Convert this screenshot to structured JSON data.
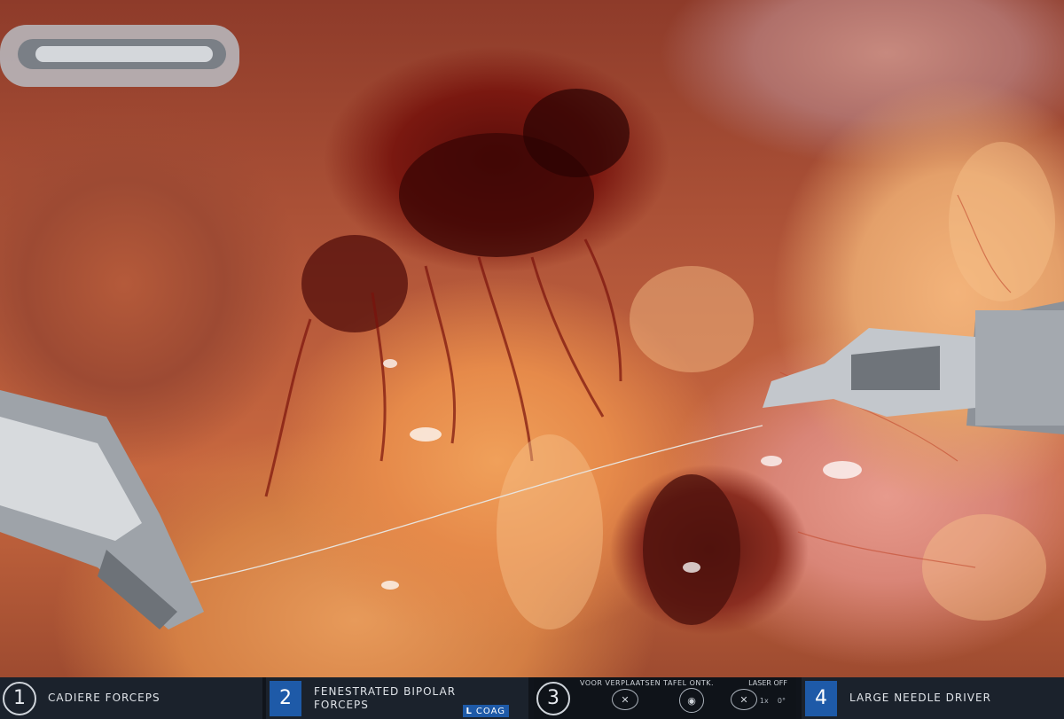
{
  "status_bar": {
    "arms": [
      {
        "number": "1",
        "tool": "CADIERE FORCEPS"
      },
      {
        "number": "2",
        "tool_line1": "FENESTRATED BIPOLAR",
        "tool_line2": "FORCEPS",
        "energy_side": "L",
        "energy_mode": "COAG"
      },
      {
        "number": "3",
        "header": "VOOR VERPLAATSEN TAFEL ONTK.",
        "laser": "LASER OFF",
        "zoom": "1x",
        "angle": "0°"
      },
      {
        "number": "4",
        "tool": "LARGE NEEDLE DRIVER"
      }
    ]
  },
  "colors": {
    "status_bg": "#1b222c",
    "active_arm_blue": "#1e5aa8",
    "tissue_fat": "#e68a4a",
    "blood": "#5a0d0a"
  }
}
